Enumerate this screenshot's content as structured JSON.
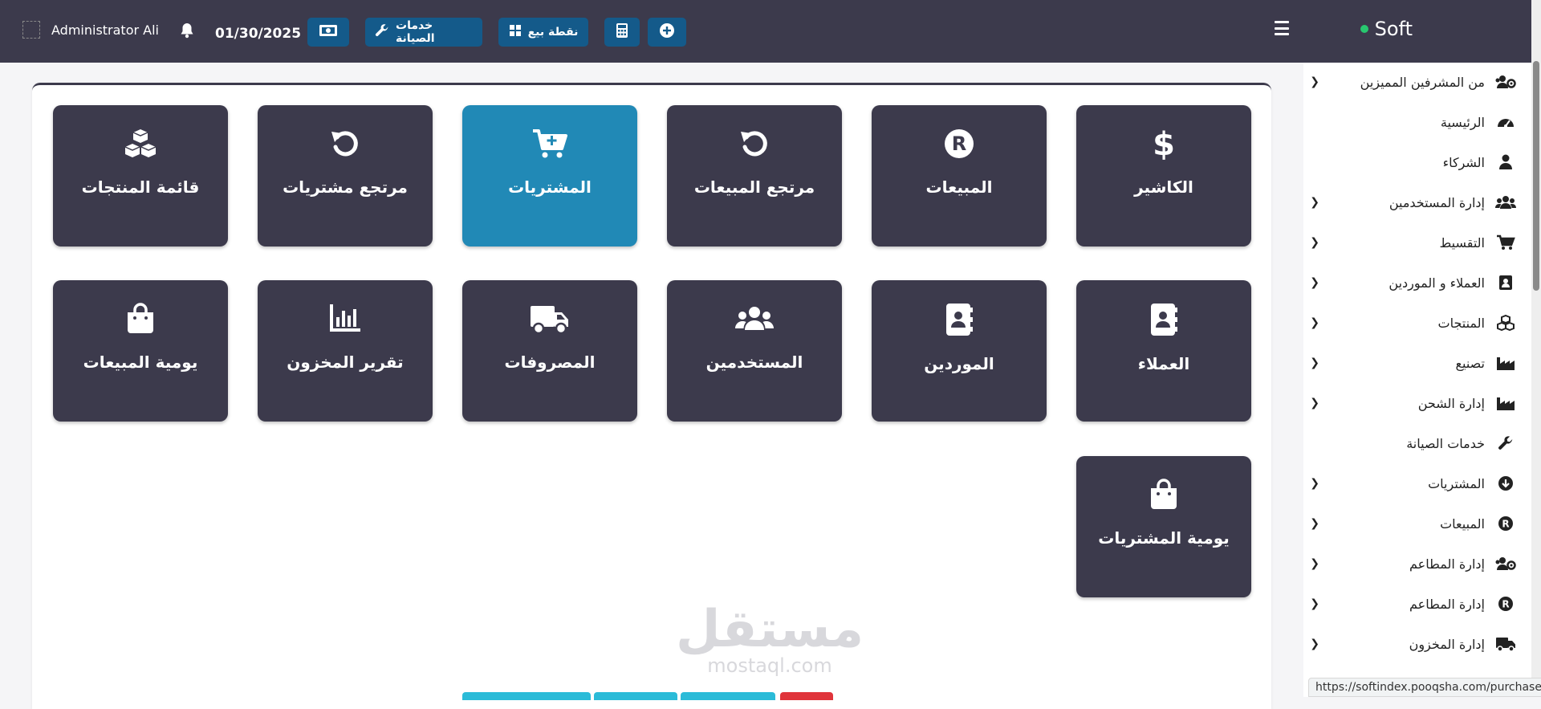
{
  "header": {
    "brand": "Soft",
    "user_name": "Administrator Ali",
    "date": "01/30/2025",
    "maintenance_label": "خدمات الصيانة",
    "pos_label": "نقطة بيع"
  },
  "sidebar": {
    "items": [
      {
        "label": "من المشرفين المميزين",
        "icon": "users-gear-icon",
        "chevron": true
      },
      {
        "label": "الرئيسية",
        "icon": "gauge-icon",
        "chevron": false
      },
      {
        "label": "الشركاء",
        "icon": "user-icon",
        "chevron": false
      },
      {
        "label": "إدارة المستخدمين",
        "icon": "users-icon",
        "chevron": true
      },
      {
        "label": "التقسيط",
        "icon": "cart-plus-icon",
        "chevron": true
      },
      {
        "label": "العملاء و الموردين",
        "icon": "contact-card-icon",
        "chevron": true
      },
      {
        "label": "المنتجات",
        "icon": "cubes-icon",
        "chevron": true
      },
      {
        "label": "تصنيع",
        "icon": "industry-icon",
        "chevron": true
      },
      {
        "label": "إدارة الشحن",
        "icon": "industry-icon",
        "chevron": true
      },
      {
        "label": "خدمات الصيانة",
        "icon": "wrench-icon",
        "chevron": false
      },
      {
        "label": "المشتريات",
        "icon": "circle-arrow-down-icon",
        "chevron": true
      },
      {
        "label": "المبيعات",
        "icon": "circle-r-icon",
        "chevron": true
      },
      {
        "label": "إدارة المطاعم",
        "icon": "users-gear-icon",
        "chevron": true
      },
      {
        "label": "إدارة المطاعم",
        "icon": "circle-r-icon",
        "chevron": true
      },
      {
        "label": "إدارة المخزون",
        "icon": "truck-icon",
        "chevron": true
      }
    ]
  },
  "tiles": [
    {
      "label": "الكاشير",
      "icon": "dollar-icon"
    },
    {
      "label": "المبيعات",
      "icon": "circle-r-icon"
    },
    {
      "label": "مرتجع المبيعات",
      "icon": "undo-icon"
    },
    {
      "label": "المشتريات",
      "icon": "cart-plus-icon"
    },
    {
      "label": "مرتجع مشتريات",
      "icon": "undo-icon"
    },
    {
      "label": "قائمة المنتجات",
      "icon": "cubes-icon"
    },
    {
      "label": "العملاء",
      "icon": "contact-book-icon"
    },
    {
      "label": "الموردين",
      "icon": "contact-book-icon"
    },
    {
      "label": "المستخدمين",
      "icon": "users-icon"
    },
    {
      "label": "المصروفات",
      "icon": "truck-icon"
    },
    {
      "label": "تقرير المخزون",
      "icon": "bar-chart-icon"
    },
    {
      "label": "يومية المبيعات",
      "icon": "shopping-bag-icon"
    },
    {
      "label": "يومية المشتريات",
      "icon": "shopping-bag-icon"
    }
  ],
  "watermark": {
    "line1": "مستقل",
    "line2": "mostaql.com"
  },
  "status_url": "https://softindex.pooqsha.com/purchases",
  "colors": {
    "topbar": "#3c3a4c",
    "tile": "#3c3a4c",
    "tile_active": "#2189b6",
    "button": "#145a8a",
    "online": "#28c76f"
  }
}
